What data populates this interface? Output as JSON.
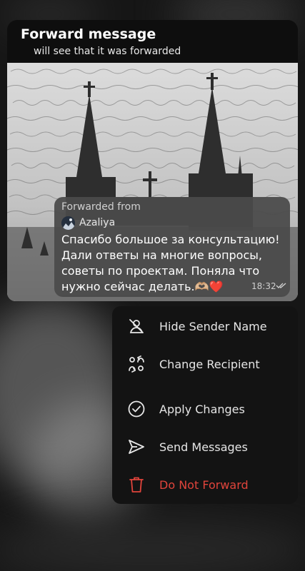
{
  "header": {
    "title": "Forward message",
    "subtitle": "will see that it was forwarded"
  },
  "message": {
    "forwarded_label": "Forwarded from",
    "sender_name": "Azaliya",
    "text": "Спасибо большое за консультацию! Дали ответы на многие вопросы, советы по проектам. Поняла что нужно сейчас делать.🫶🏼❤️",
    "time": "18:32",
    "status_icon": "double-check-icon"
  },
  "menu": {
    "items": [
      {
        "label": "Hide Sender Name",
        "icon": "hide-sender-icon"
      },
      {
        "label": "Change Recipient",
        "icon": "change-recipient-icon"
      },
      {
        "label": "Apply Changes",
        "icon": "check-circle-icon"
      },
      {
        "label": "Send Messages",
        "icon": "send-icon"
      },
      {
        "label": "Do Not Forward",
        "icon": "trash-icon"
      }
    ]
  },
  "colors": {
    "menu_background": "#131313",
    "danger": "#e0443b",
    "bubble": "#4a4a4a",
    "header_background": "#0e0e0e"
  }
}
